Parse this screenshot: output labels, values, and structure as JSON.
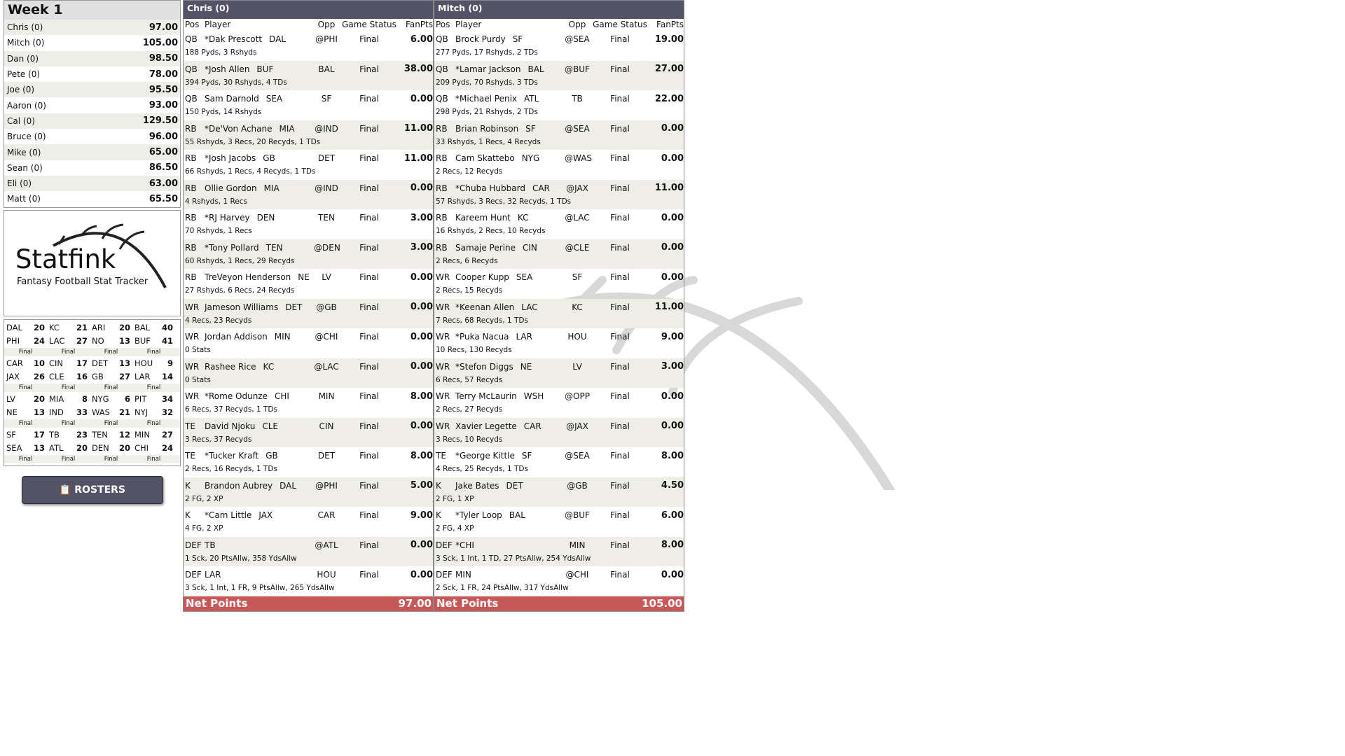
{
  "week_title": "Week 1",
  "standings": [
    {
      "name": "Chris (0)",
      "pts": "97.00"
    },
    {
      "name": "Mitch (0)",
      "pts": "105.00"
    },
    {
      "name": "Dan (0)",
      "pts": "98.50"
    },
    {
      "name": "Pete (0)",
      "pts": "78.00"
    },
    {
      "name": "Joe (0)",
      "pts": "95.50"
    },
    {
      "name": "Aaron (0)",
      "pts": "93.00"
    },
    {
      "name": "Cal (0)",
      "pts": "129.50"
    },
    {
      "name": "Bruce (0)",
      "pts": "96.00"
    },
    {
      "name": "Mike (0)",
      "pts": "65.00"
    },
    {
      "name": "Sean (0)",
      "pts": "86.50"
    },
    {
      "name": "Eli (0)",
      "pts": "63.00"
    },
    {
      "name": "Matt (0)",
      "pts": "65.50"
    }
  ],
  "logo": {
    "brand": "Statfink",
    "tagline": "Fantasy Football Stat Tracker"
  },
  "game_scores": [
    [
      {
        "t1": "DAL",
        "s1": "20",
        "t2": "PHI",
        "s2": "24",
        "status": "Final"
      },
      {
        "t1": "KC",
        "s1": "21",
        "t2": "LAC",
        "s2": "27",
        "status": "Final"
      },
      {
        "t1": "ARI",
        "s1": "20",
        "t2": "NO",
        "s2": "13",
        "status": "Final"
      },
      {
        "t1": "BAL",
        "s1": "40",
        "t2": "BUF",
        "s2": "41",
        "status": "Final"
      }
    ],
    [
      {
        "t1": "CAR",
        "s1": "10",
        "t2": "JAX",
        "s2": "26",
        "status": "Final"
      },
      {
        "t1": "CIN",
        "s1": "17",
        "t2": "CLE",
        "s2": "16",
        "status": "Final"
      },
      {
        "t1": "DET",
        "s1": "13",
        "t2": "GB",
        "s2": "27",
        "status": "Final"
      },
      {
        "t1": "HOU",
        "s1": "9",
        "t2": "LAR",
        "s2": "14",
        "status": "Final"
      }
    ],
    [
      {
        "t1": "LV",
        "s1": "20",
        "t2": "NE",
        "s2": "13",
        "status": "Final"
      },
      {
        "t1": "MIA",
        "s1": "8",
        "t2": "IND",
        "s2": "33",
        "status": "Final"
      },
      {
        "t1": "NYG",
        "s1": "6",
        "t2": "WAS",
        "s2": "21",
        "status": "Final"
      },
      {
        "t1": "PIT",
        "s1": "34",
        "t2": "NYJ",
        "s2": "32",
        "status": "Final"
      }
    ],
    [
      {
        "t1": "SF",
        "s1": "17",
        "t2": "SEA",
        "s2": "13",
        "status": "Final"
      },
      {
        "t1": "TB",
        "s1": "23",
        "t2": "ATL",
        "s2": "20",
        "status": "Final"
      },
      {
        "t1": "TEN",
        "s1": "12",
        "t2": "DEN",
        "s2": "20",
        "status": "Final"
      },
      {
        "t1": "MIN",
        "s1": "27",
        "t2": "CHI",
        "s2": "24",
        "status": "Final"
      }
    ]
  ],
  "rosters_button": "📋 ROSTERS",
  "columns": {
    "pos": "Pos",
    "player": "Player",
    "opp": "Opp",
    "status": "Game Status",
    "pts": "FanPts"
  },
  "teams": [
    {
      "title": "Chris (0)",
      "net_label": "Net Points",
      "net_value": "97.00",
      "players": [
        {
          "pos": "QB",
          "name": "*Dak Prescott",
          "team": "DAL",
          "opp": "@PHI",
          "status": "Final",
          "pts": "6.00",
          "stats": "188 Pyds, 3 Rshyds"
        },
        {
          "pos": "QB",
          "name": "*Josh Allen",
          "team": "BUF",
          "opp": "BAL",
          "status": "Final",
          "pts": "38.00",
          "stats": "394 Pyds, 30 Rshyds, 4 TDs"
        },
        {
          "pos": "QB",
          "name": "Sam Darnold",
          "team": "SEA",
          "opp": "SF",
          "status": "Final",
          "pts": "0.00",
          "stats": "150 Pyds, 14 Rshyds"
        },
        {
          "pos": "RB",
          "name": "*De'Von Achane",
          "team": "MIA",
          "opp": "@IND",
          "status": "Final",
          "pts": "11.00",
          "stats": "55 Rshyds, 3 Recs, 20 Recyds, 1 TDs"
        },
        {
          "pos": "RB",
          "name": "*Josh Jacobs",
          "team": "GB",
          "opp": "DET",
          "status": "Final",
          "pts": "11.00",
          "stats": "66 Rshyds, 1 Recs, 4 Recyds, 1 TDs"
        },
        {
          "pos": "RB",
          "name": "Ollie Gordon",
          "team": "MIA",
          "opp": "@IND",
          "status": "Final",
          "pts": "0.00",
          "stats": "4 Rshyds, 1 Recs"
        },
        {
          "pos": "RB",
          "name": "*RJ Harvey",
          "team": "DEN",
          "opp": "TEN",
          "status": "Final",
          "pts": "3.00",
          "stats": "70 Rshyds, 1 Recs"
        },
        {
          "pos": "RB",
          "name": "*Tony Pollard",
          "team": "TEN",
          "opp": "@DEN",
          "status": "Final",
          "pts": "3.00",
          "stats": "60 Rshyds, 1 Recs, 29 Recyds"
        },
        {
          "pos": "RB",
          "name": "TreVeyon Henderson",
          "team": "NE",
          "opp": "LV",
          "status": "Final",
          "pts": "0.00",
          "stats": "27 Rshyds, 6 Recs, 24 Recyds"
        },
        {
          "pos": "WR",
          "name": "Jameson Williams",
          "team": "DET",
          "opp": "@GB",
          "status": "Final",
          "pts": "0.00",
          "stats": "4 Recs, 23 Recyds"
        },
        {
          "pos": "WR",
          "name": "Jordan Addison",
          "team": "MIN",
          "opp": "@CHI",
          "status": "Final",
          "pts": "0.00",
          "stats": "0 Stats"
        },
        {
          "pos": "WR",
          "name": "Rashee Rice",
          "team": "KC",
          "opp": "@LAC",
          "status": "Final",
          "pts": "0.00",
          "stats": "0 Stats"
        },
        {
          "pos": "WR",
          "name": "*Rome Odunze",
          "team": "CHI",
          "opp": "MIN",
          "status": "Final",
          "pts": "8.00",
          "stats": "6 Recs, 37 Recyds, 1 TDs"
        },
        {
          "pos": "TE",
          "name": "David Njoku",
          "team": "CLE",
          "opp": "CIN",
          "status": "Final",
          "pts": "0.00",
          "stats": "3 Recs, 37 Recyds"
        },
        {
          "pos": "TE",
          "name": "*Tucker Kraft",
          "team": "GB",
          "opp": "DET",
          "status": "Final",
          "pts": "8.00",
          "stats": "2 Recs, 16 Recyds, 1 TDs"
        },
        {
          "pos": "K",
          "name": "Brandon Aubrey",
          "team": "DAL",
          "opp": "@PHI",
          "status": "Final",
          "pts": "5.00",
          "stats": "2 FG, 2 XP"
        },
        {
          "pos": "K",
          "name": "*Cam Little",
          "team": "JAX",
          "opp": "CAR",
          "status": "Final",
          "pts": "9.00",
          "stats": "4 FG, 2 XP"
        },
        {
          "pos": "DEF",
          "name": "TB",
          "team": "",
          "opp": "@ATL",
          "status": "Final",
          "pts": "0.00",
          "stats": "1 Sck, 20 PtsAllw, 358 YdsAllw"
        },
        {
          "pos": "DEF",
          "name": "LAR",
          "team": "",
          "opp": "HOU",
          "status": "Final",
          "pts": "0.00",
          "stats": "3 Sck, 1 Int, 1 FR, 9 PtsAllw, 265 YdsAllw"
        }
      ]
    },
    {
      "title": "Mitch (0)",
      "net_label": "Net Points",
      "net_value": "105.00",
      "players": [
        {
          "pos": "QB",
          "name": "Brock Purdy",
          "team": "SF",
          "opp": "@SEA",
          "status": "Final",
          "pts": "19.00",
          "stats": "277 Pyds, 17 Rshyds, 2 TDs"
        },
        {
          "pos": "QB",
          "name": "*Lamar Jackson",
          "team": "BAL",
          "opp": "@BUF",
          "status": "Final",
          "pts": "27.00",
          "stats": "209 Pyds, 70 Rshyds, 3 TDs"
        },
        {
          "pos": "QB",
          "name": "*Michael Penix",
          "team": "ATL",
          "opp": "TB",
          "status": "Final",
          "pts": "22.00",
          "stats": "298 Pyds, 21 Rshyds, 2 TDs"
        },
        {
          "pos": "RB",
          "name": "Brian Robinson",
          "team": "SF",
          "opp": "@SEA",
          "status": "Final",
          "pts": "0.00",
          "stats": "33 Rshyds, 1 Recs, 4 Recyds"
        },
        {
          "pos": "RB",
          "name": "Cam Skattebo",
          "team": "NYG",
          "opp": "@WAS",
          "status": "Final",
          "pts": "0.00",
          "stats": "2 Recs, 12 Recyds"
        },
        {
          "pos": "RB",
          "name": "*Chuba Hubbard",
          "team": "CAR",
          "opp": "@JAX",
          "status": "Final",
          "pts": "11.00",
          "stats": "57 Rshyds, 3 Recs, 32 Recyds, 1 TDs"
        },
        {
          "pos": "RB",
          "name": "Kareem Hunt",
          "team": "KC",
          "opp": "@LAC",
          "status": "Final",
          "pts": "0.00",
          "stats": "16 Rshyds, 2 Recs, 10 Recyds"
        },
        {
          "pos": "RB",
          "name": "Samaje Perine",
          "team": "CIN",
          "opp": "@CLE",
          "status": "Final",
          "pts": "0.00",
          "stats": "2 Recs, 6 Recyds"
        },
        {
          "pos": "WR",
          "name": "Cooper Kupp",
          "team": "SEA",
          "opp": "SF",
          "status": "Final",
          "pts": "0.00",
          "stats": "2 Recs, 15 Recyds"
        },
        {
          "pos": "WR",
          "name": "*Keenan Allen",
          "team": "LAC",
          "opp": "KC",
          "status": "Final",
          "pts": "11.00",
          "stats": "7 Recs, 68 Recyds, 1 TDs"
        },
        {
          "pos": "WR",
          "name": "*Puka Nacua",
          "team": "LAR",
          "opp": "HOU",
          "status": "Final",
          "pts": "9.00",
          "stats": "10 Recs, 130 Recyds"
        },
        {
          "pos": "WR",
          "name": "*Stefon Diggs",
          "team": "NE",
          "opp": "LV",
          "status": "Final",
          "pts": "3.00",
          "stats": "6 Recs, 57 Recyds"
        },
        {
          "pos": "WR",
          "name": "Terry McLaurin",
          "team": "WSH",
          "opp": "@OPP",
          "status": "Final",
          "pts": "0.00",
          "stats": "2 Recs, 27 Recyds"
        },
        {
          "pos": "WR",
          "name": "Xavier Legette",
          "team": "CAR",
          "opp": "@JAX",
          "status": "Final",
          "pts": "0.00",
          "stats": "3 Recs, 10 Recyds"
        },
        {
          "pos": "TE",
          "name": "*George Kittle",
          "team": "SF",
          "opp": "@SEA",
          "status": "Final",
          "pts": "8.00",
          "stats": "4 Recs, 25 Recyds, 1 TDs"
        },
        {
          "pos": "K",
          "name": "Jake Bates",
          "team": "DET",
          "opp": "@GB",
          "status": "Final",
          "pts": "4.50",
          "stats": "2 FG, 1 XP"
        },
        {
          "pos": "K",
          "name": "*Tyler Loop",
          "team": "BAL",
          "opp": "@BUF",
          "status": "Final",
          "pts": "6.00",
          "stats": "2 FG, 4 XP"
        },
        {
          "pos": "DEF",
          "name": "*CHI",
          "team": "",
          "opp": "MIN",
          "status": "Final",
          "pts": "8.00",
          "stats": "3 Sck, 1 Int, 1 TD, 27 PtsAllw, 254 YdsAllw"
        },
        {
          "pos": "DEF",
          "name": "MIN",
          "team": "",
          "opp": "@CHI",
          "status": "Final",
          "pts": "0.00",
          "stats": "2 Sck, 1 FR, 24 PtsAllw, 317 YdsAllw"
        }
      ]
    }
  ]
}
